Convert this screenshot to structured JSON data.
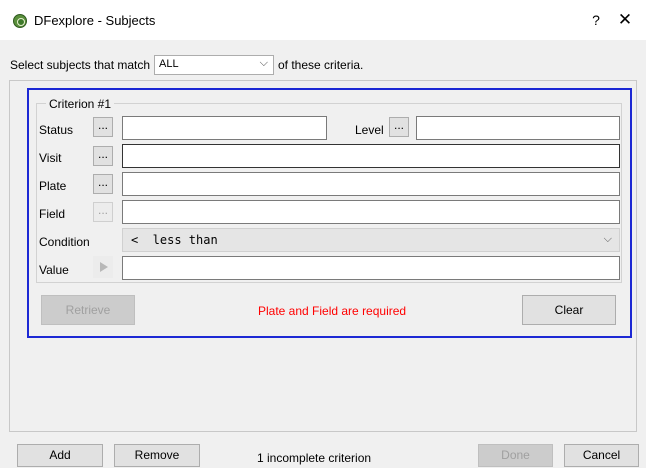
{
  "window": {
    "title": "DFexplore - Subjects",
    "help_label": "?",
    "close_label": "✕"
  },
  "match": {
    "prefix": "Select subjects that match",
    "selected": "ALL",
    "suffix": "of these criteria."
  },
  "criterion": {
    "title": "Criterion #1",
    "status_label": "Status",
    "level_label": "Level",
    "visit_label": "Visit",
    "plate_label": "Plate",
    "field_label": "Field",
    "condition_label": "Condition",
    "condition_value": "<  less than",
    "value_label": "Value",
    "dots_label": "..."
  },
  "actions": {
    "retrieve_label": "Retrieve",
    "warning": "Plate and Field are required",
    "clear_label": "Clear"
  },
  "footer": {
    "add_label": "Add",
    "remove_label": "Remove",
    "status": "1 incomplete criterion",
    "done_label": "Done",
    "cancel_label": "Cancel"
  },
  "colors": {
    "panel_border": "#1c28d4",
    "warning": "#ff0000"
  },
  "icons": {
    "app": "dfexplore-app-icon",
    "condition_chevron": "chevron-down-icon",
    "value_button": "play-icon"
  }
}
